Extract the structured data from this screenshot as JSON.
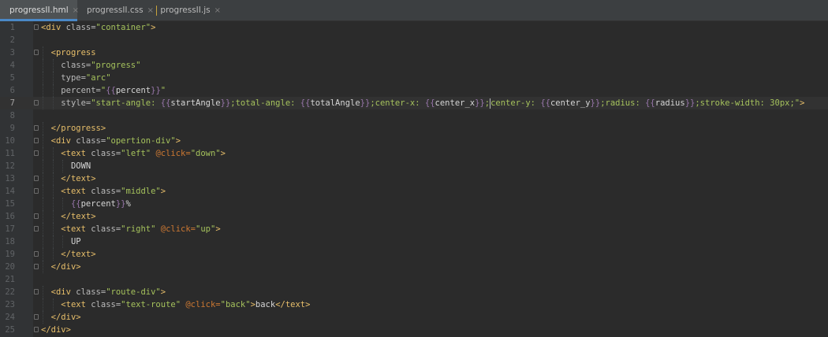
{
  "tabs": [
    {
      "label": "progressII.hml",
      "kind": "html",
      "active": true
    },
    {
      "label": "progressII.css",
      "kind": "css",
      "active": false
    },
    {
      "label": "progressII.js",
      "kind": "js",
      "active": false
    }
  ],
  "tab_close_glyph": "×",
  "editor": {
    "current_line": 7,
    "lines": [
      {
        "n": "1",
        "indent": 0,
        "fold": true,
        "tokens": [
          [
            "tag",
            "<div "
          ],
          [
            "attr",
            "class="
          ],
          [
            "val",
            "\"container\""
          ],
          [
            "tag",
            ">"
          ]
        ]
      },
      {
        "n": "2",
        "indent": 0,
        "tokens": []
      },
      {
        "n": "3",
        "indent": 1,
        "fold": true,
        "tokens": [
          [
            "tag",
            "<progress"
          ]
        ]
      },
      {
        "n": "4",
        "indent": 2,
        "tokens": [
          [
            "attr",
            "class="
          ],
          [
            "val",
            "\"progress\""
          ]
        ]
      },
      {
        "n": "5",
        "indent": 2,
        "tokens": [
          [
            "attr",
            "type="
          ],
          [
            "val",
            "\"arc\""
          ]
        ]
      },
      {
        "n": "6",
        "indent": 2,
        "tokens": [
          [
            "attr",
            "percent="
          ],
          [
            "val",
            "\""
          ],
          [
            "brace",
            "{{"
          ],
          [
            "ident",
            "percent"
          ],
          [
            "brace",
            "}}"
          ],
          [
            "val",
            "\""
          ]
        ]
      },
      {
        "n": "7",
        "indent": 2,
        "fold": true,
        "tokens": [
          [
            "attr",
            "style="
          ],
          [
            "val",
            "\"start-angle: "
          ],
          [
            "brace",
            "{{"
          ],
          [
            "ident",
            "startAngle"
          ],
          [
            "brace",
            "}}"
          ],
          [
            "val",
            ";total-angle: "
          ],
          [
            "brace",
            "{{"
          ],
          [
            "ident",
            "totalAngle"
          ],
          [
            "brace",
            "}}"
          ],
          [
            "val",
            ";center-x: "
          ],
          [
            "brace",
            "{{"
          ],
          [
            "ident",
            "center_x"
          ],
          [
            "brace",
            "}}"
          ],
          [
            "val",
            ";"
          ],
          [
            "caret",
            ""
          ],
          [
            "val",
            "center-y: "
          ],
          [
            "brace",
            "{{"
          ],
          [
            "ident",
            "center_y"
          ],
          [
            "brace",
            "}}"
          ],
          [
            "val",
            ";radius: "
          ],
          [
            "brace",
            "{{"
          ],
          [
            "ident",
            "radius"
          ],
          [
            "brace",
            "}}"
          ],
          [
            "val",
            ";stroke-width: 30px;\""
          ],
          [
            "tag",
            ">"
          ]
        ]
      },
      {
        "n": "8",
        "indent": 0,
        "tokens": []
      },
      {
        "n": "9",
        "indent": 1,
        "fold": true,
        "tokens": [
          [
            "tag",
            "</progress>"
          ]
        ]
      },
      {
        "n": "10",
        "indent": 1,
        "fold": true,
        "tokens": [
          [
            "tag",
            "<div "
          ],
          [
            "attr",
            "class="
          ],
          [
            "val",
            "\"opertion-div\""
          ],
          [
            "tag",
            ">"
          ]
        ]
      },
      {
        "n": "11",
        "indent": 2,
        "fold": true,
        "tokens": [
          [
            "tag",
            "<text "
          ],
          [
            "attr",
            "class="
          ],
          [
            "val",
            "\"left\" "
          ],
          [
            "event",
            "@click="
          ],
          [
            "val",
            "\"down\""
          ],
          [
            "tag",
            ">"
          ]
        ]
      },
      {
        "n": "12",
        "indent": 3,
        "tokens": [
          [
            "txt",
            "DOWN"
          ]
        ]
      },
      {
        "n": "13",
        "indent": 2,
        "fold": true,
        "tokens": [
          [
            "tag",
            "</text>"
          ]
        ]
      },
      {
        "n": "14",
        "indent": 2,
        "fold": true,
        "tokens": [
          [
            "tag",
            "<text "
          ],
          [
            "attr",
            "class="
          ],
          [
            "val",
            "\"middle\""
          ],
          [
            "tag",
            ">"
          ]
        ]
      },
      {
        "n": "15",
        "indent": 3,
        "tokens": [
          [
            "brace",
            "{{"
          ],
          [
            "ident",
            "percent"
          ],
          [
            "brace",
            "}}"
          ],
          [
            "txt",
            "%"
          ]
        ]
      },
      {
        "n": "16",
        "indent": 2,
        "fold": true,
        "tokens": [
          [
            "tag",
            "</text>"
          ]
        ]
      },
      {
        "n": "17",
        "indent": 2,
        "fold": true,
        "tokens": [
          [
            "tag",
            "<text "
          ],
          [
            "attr",
            "class="
          ],
          [
            "val",
            "\"right\" "
          ],
          [
            "event",
            "@click="
          ],
          [
            "val",
            "\"up\""
          ],
          [
            "tag",
            ">"
          ]
        ]
      },
      {
        "n": "18",
        "indent": 3,
        "tokens": [
          [
            "txt",
            "UP"
          ]
        ]
      },
      {
        "n": "19",
        "indent": 2,
        "fold": true,
        "tokens": [
          [
            "tag",
            "</text>"
          ]
        ]
      },
      {
        "n": "20",
        "indent": 1,
        "fold": true,
        "tokens": [
          [
            "tag",
            "</div>"
          ]
        ]
      },
      {
        "n": "21",
        "indent": 0,
        "tokens": []
      },
      {
        "n": "22",
        "indent": 1,
        "fold": true,
        "tokens": [
          [
            "tag",
            "<div "
          ],
          [
            "attr",
            "class="
          ],
          [
            "val",
            "\"route-div\""
          ],
          [
            "tag",
            ">"
          ]
        ]
      },
      {
        "n": "23",
        "indent": 2,
        "tokens": [
          [
            "tag",
            "<text "
          ],
          [
            "attr",
            "class="
          ],
          [
            "val",
            "\"text-route\" "
          ],
          [
            "event",
            "@click="
          ],
          [
            "val",
            "\"back\""
          ],
          [
            "tag",
            ">"
          ],
          [
            "txt",
            "back"
          ],
          [
            "tag",
            "</text>"
          ]
        ]
      },
      {
        "n": "24",
        "indent": 1,
        "fold": true,
        "tokens": [
          [
            "tag",
            "</div>"
          ]
        ]
      },
      {
        "n": "25",
        "indent": 0,
        "fold": true,
        "tokens": [
          [
            "tag",
            "</div>"
          ]
        ]
      }
    ]
  }
}
